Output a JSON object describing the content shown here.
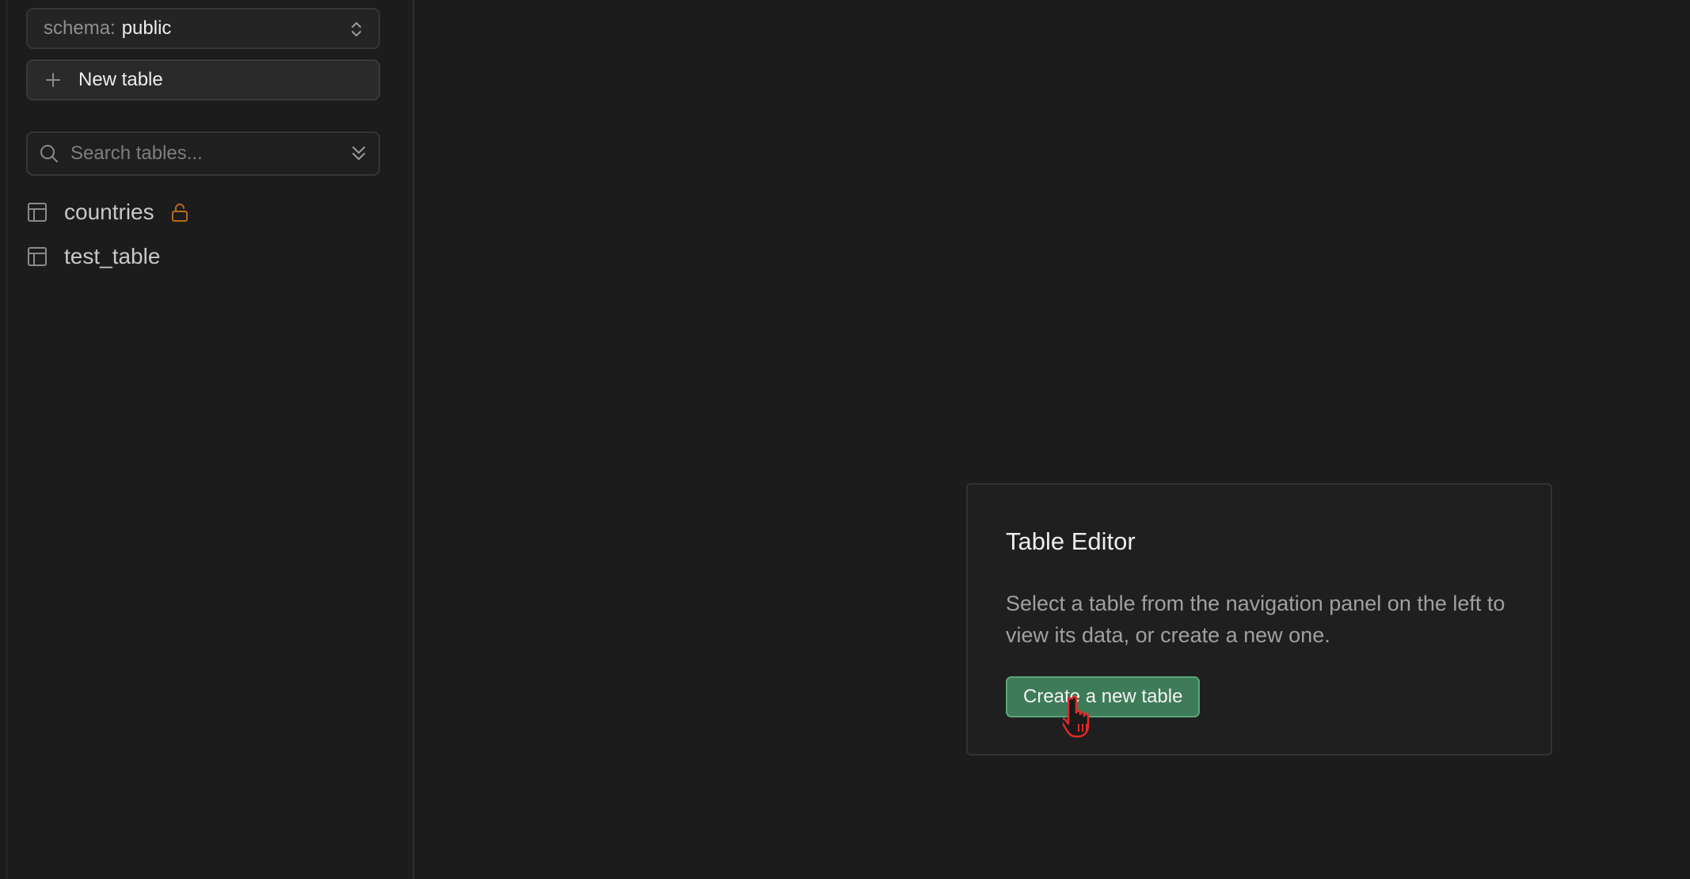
{
  "sidebar": {
    "schema_prefix": "schema:",
    "schema_value": "public",
    "new_table_label": "New table",
    "search_placeholder": "Search tables...",
    "tables": [
      {
        "name": "countries",
        "locked": true
      },
      {
        "name": "test_table",
        "locked": false
      }
    ]
  },
  "main": {
    "card": {
      "title": "Table Editor",
      "description": "Select a table from the navigation panel on the left to view its data, or create a new one.",
      "button_label": "Create a new table"
    }
  },
  "colors": {
    "background": "#1c1c1c",
    "accent_green": "#3e7b58",
    "lock_orange": "#b86a1a"
  },
  "icons": {
    "schema_chevrons": "chevron-up-down-icon",
    "new_table": "plus-icon",
    "search": "search-icon",
    "collapse": "chevrons-down-icon",
    "table": "table-icon",
    "lock": "unlock-icon",
    "cursor": "hand-pointer-icon"
  }
}
